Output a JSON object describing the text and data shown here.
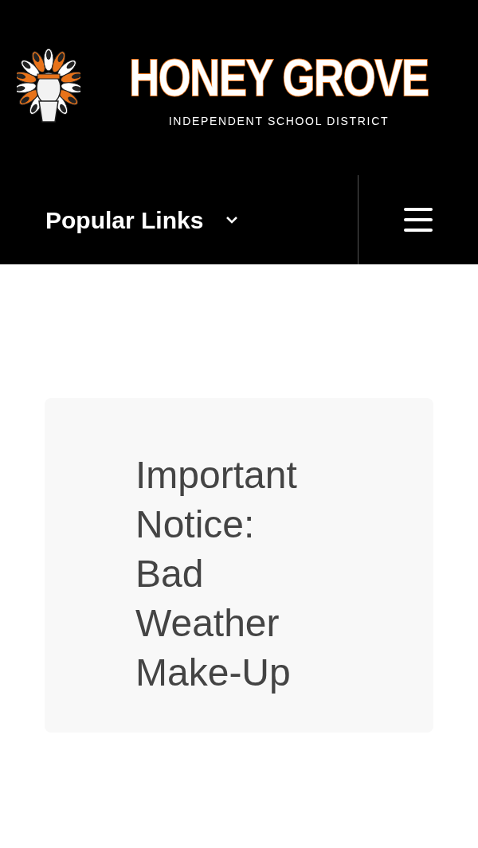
{
  "header": {
    "logo_title": "HONEY GROVE",
    "logo_subtitle": "INDEPENDENT SCHOOL DISTRICT"
  },
  "nav": {
    "popular_links": {
      "label": "Popular Links",
      "expanded": false
    }
  },
  "notice": {
    "title": "Important Notice: Bad Weather Make-Up"
  }
}
